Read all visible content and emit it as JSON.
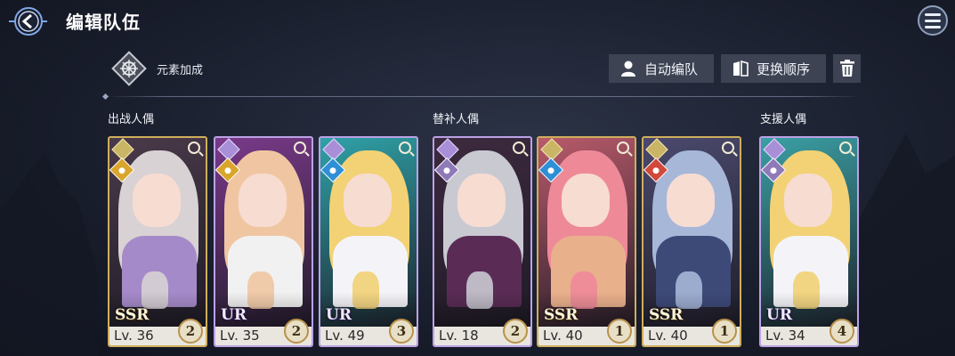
{
  "header": {
    "title": "编辑队伍",
    "back_icon": "back-arrow-icon",
    "menu_icon": "menu-icon"
  },
  "element_bonus": {
    "label": "元素加成",
    "icon": "element-emblem-icon"
  },
  "toolbar": {
    "auto_label": "自动编队",
    "auto_icon": "person-icon",
    "order_label": "更换顺序",
    "order_icon": "book-icon",
    "delete_icon": "trash-icon"
  },
  "sections": {
    "battle": "出战人偶",
    "substitute": "替补人偶",
    "support": "支援人偶"
  },
  "cards": [
    {
      "section": "battle",
      "rarity": "SSR",
      "level": "Lv. 36",
      "rank": "2",
      "element": "earth",
      "element_color": "#d9a52c",
      "hair": "#d8d2d4",
      "body": "#a58ac9",
      "bg": "#4a3a4a"
    },
    {
      "section": "battle",
      "rarity": "UR",
      "level": "Lv. 35",
      "rank": "2",
      "element": "earth",
      "element_color": "#d9a52c",
      "hair": "#f0c6a2",
      "body": "#f1f1f1",
      "bg": "#7a3a8a"
    },
    {
      "section": "battle",
      "rarity": "UR",
      "level": "Lv. 49",
      "rank": "3",
      "element": "water",
      "element_color": "#2e8fd6",
      "hair": "#f2d275",
      "body": "#f4f4f8",
      "bg": "#2fa2a8"
    },
    {
      "section": "substitute",
      "rarity": "",
      "level": "Lv. 18",
      "rank": "2",
      "element": "wind",
      "element_color": "#8f7ab8",
      "hair": "#c9c9d2",
      "body": "#5a2c55",
      "bg": "#3e2a40"
    },
    {
      "section": "substitute",
      "rarity": "SSR",
      "level": "Lv. 40",
      "rank": "1",
      "element": "water",
      "element_color": "#2e8fd6",
      "hair": "#ee8a98",
      "body": "#e9b08c",
      "bg": "#b85a6a"
    },
    {
      "section": "substitute",
      "rarity": "SSR",
      "level": "Lv. 40",
      "rank": "1",
      "element": "fire",
      "element_color": "#d2483a",
      "hair": "#a6b7d8",
      "body": "#3d4a78",
      "bg": "#4b4a6e"
    },
    {
      "section": "support",
      "rarity": "UR",
      "level": "Lv. 34",
      "rank": "4",
      "element": "wind",
      "element_color": "#8f7ab8",
      "hair": "#f2d275",
      "body": "#f4f4f8",
      "bg": "#3aa0a4"
    }
  ]
}
